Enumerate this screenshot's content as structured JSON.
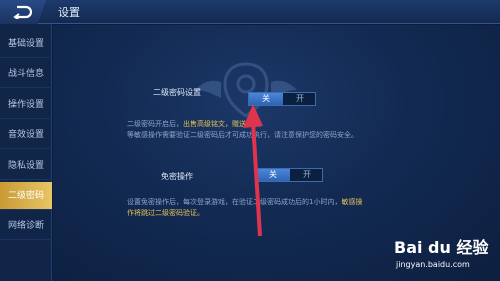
{
  "header": {
    "title": "设置"
  },
  "sidebar": {
    "items": [
      {
        "label": "基础设置"
      },
      {
        "label": "战斗信息"
      },
      {
        "label": "操作设置"
      },
      {
        "label": "音效设置"
      },
      {
        "label": "隐私设置"
      },
      {
        "label": "二级密码",
        "active": true
      },
      {
        "label": "网络诊断"
      }
    ]
  },
  "secondary_password": {
    "label": "二级密码设置",
    "off_label": "关",
    "on_label": "开",
    "selected": "关",
    "desc_line1_a": "二级密码开启后，",
    "desc_line1_hl": "出售高级铭文，赠送皮肤",
    "desc_line2": "等敏感操作需要验证二级密码后才可成功执行，请注意保护您的密码安全。"
  },
  "password_free": {
    "label": "免密操作",
    "off_label": "关",
    "on_label": "开",
    "selected": "关",
    "desc_line1_a": "设置免密操作后，每次登录游戏，在验证二级密码成功后的1小时内，",
    "desc_line1_hl": "敏感操",
    "desc_line2_hl": "作将跳过二级密码验证。"
  },
  "watermark": {
    "logo": "Bai du 经验",
    "url": "jingyan.baidu.com"
  },
  "colors": {
    "accent_active": "#e8c565",
    "highlight_text": "#e8c35a",
    "arrow": "#e0344e"
  },
  "icons": {
    "back": "back-arrow-icon"
  }
}
